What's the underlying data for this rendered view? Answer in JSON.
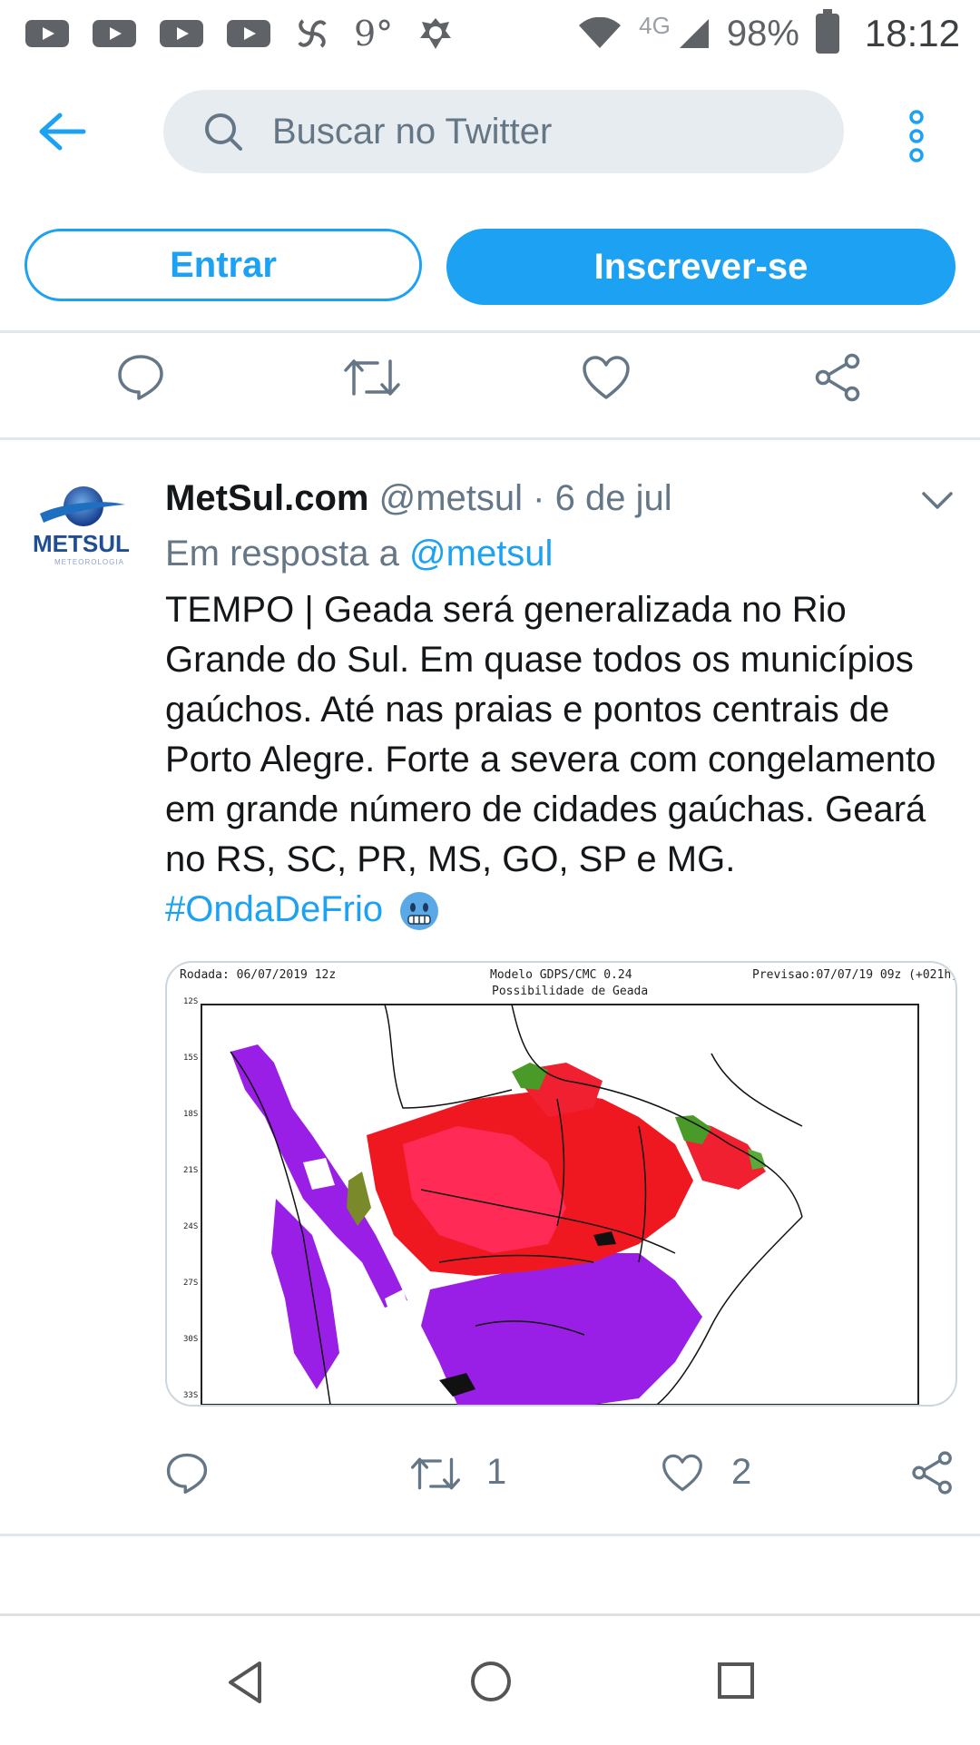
{
  "status_bar": {
    "notification_icons": [
      "youtube-icon",
      "youtube-icon",
      "youtube-icon",
      "youtube-icon",
      "pinwheel-icon",
      "weather-icon",
      "bug-icon"
    ],
    "temperature": "9°",
    "network": "4G",
    "battery": "98%",
    "time": "18:12"
  },
  "header": {
    "search_placeholder": "Buscar no Twitter"
  },
  "auth": {
    "login_label": "Entrar",
    "signup_label": "Inscrever-se"
  },
  "tweet": {
    "author_name": "MetSul.com",
    "author_handle": "@metsul",
    "separator": "·",
    "date": "6 de jul",
    "reply_prefix": "Em resposta a",
    "reply_handle": "@metsul",
    "text": "TEMPO | Geada será generalizada no Rio Grande do Sul. Em quase todos os municípios gaúchos. Até nas praias e pontos centrais de Porto Alegre. Forte a severa com congelamento em grande número de cidades gaúchas. Geará no RS, SC, PR, MS, GO, SP e MG.",
    "hashtag": "#OndaDeFrio",
    "avatar_text": "METSUL",
    "avatar_subtext": "METEOROLOGIA",
    "media": {
      "run": "Rodada: 06/07/2019 12z",
      "model": "Modelo GDPS/CMC 0.24",
      "forecast": "Previsao:07/07/19 09z (+021h)",
      "subtitle": "Possibilidade de Geada",
      "lat_ticks": [
        "12S",
        "15S",
        "18S",
        "21S",
        "24S",
        "27S",
        "30S",
        "33S"
      ]
    },
    "retweets": "1",
    "likes": "2"
  }
}
